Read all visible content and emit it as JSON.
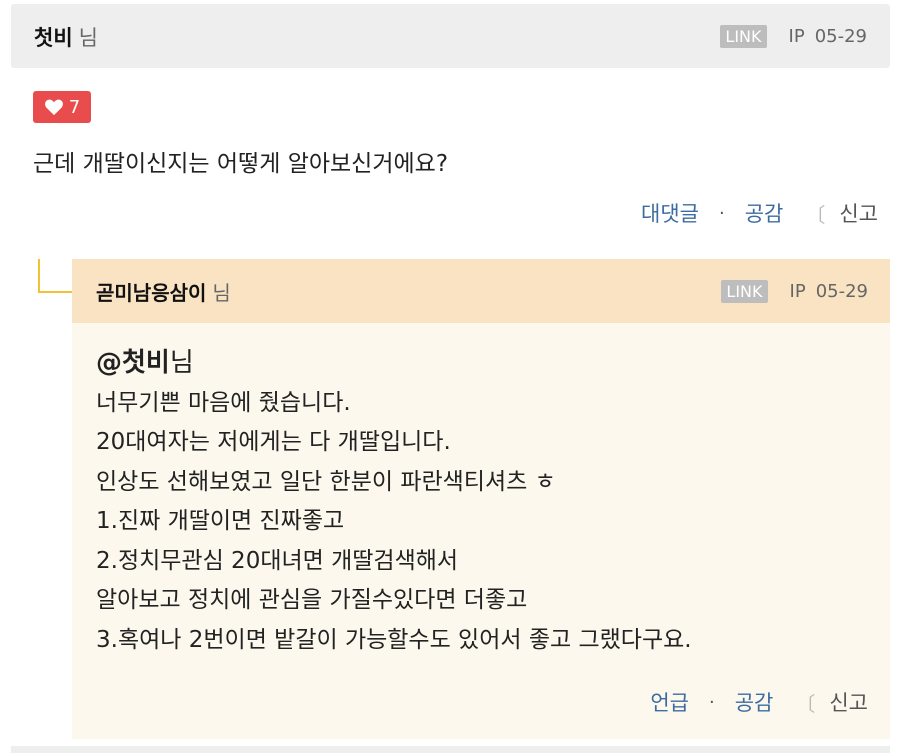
{
  "comment1": {
    "author": "첫비",
    "author_suffix": "님",
    "link_badge": "LINK",
    "ip": "IP",
    "date": "05-29",
    "like_count": "7",
    "body": "근데 개딸이신지는 어떻게 알아보신거에요?",
    "actions": {
      "reply": "대댓글",
      "dot": "·",
      "like": "공감",
      "bracket": "〔",
      "report": "신고"
    }
  },
  "reply": {
    "author": "곧미남응삼이",
    "author_suffix": "님",
    "link_badge": "LINK",
    "ip": "IP",
    "date": "05-29",
    "mention_name": "@첫비",
    "mention_suffix": "님",
    "lines": [
      "너무기쁜 마음에 줬습니다.",
      "20대여자는 저에게는 다 개딸입니다.",
      "인상도 선해보였고 일단 한분이 파란색티셔츠 ㅎ",
      "1.진짜 개딸이면 진짜좋고",
      "2.정치무관심 20대녀면 개딸검색해서",
      "알아보고 정치에 관심을 가질수있다면 더좋고",
      "3.혹여나 2번이면 밭갈이 가능할수도 있어서 좋고 그랬다구요."
    ],
    "actions": {
      "mention": "언급",
      "dot": "·",
      "like": "공감",
      "bracket": "〔",
      "report": "신고"
    }
  },
  "colors": {
    "like_badge": "#e84c4c",
    "action_link": "#3d6ca0",
    "reply_header": "#f9e3c2",
    "reply_body": "#fdf8ee",
    "reply_line": "#f2c233"
  },
  "icons": {
    "like": "heart-icon"
  }
}
